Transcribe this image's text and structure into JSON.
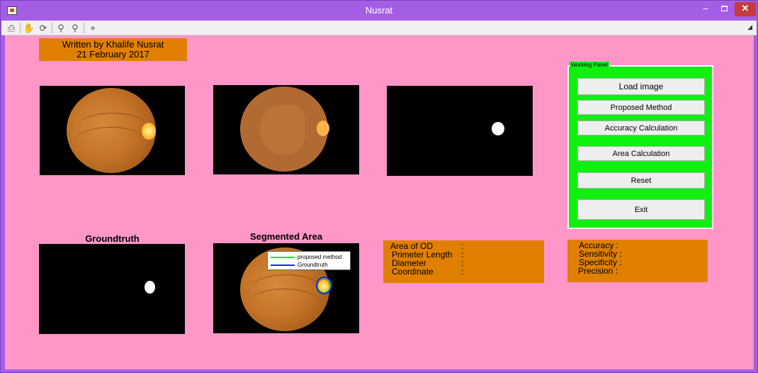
{
  "window": {
    "title": "Nusrat"
  },
  "toolbar": {
    "icons": [
      "print-icon",
      "pan-icon",
      "rotate-3d-icon",
      "zoom-in-icon",
      "zoom-out-icon",
      "data-cursor-icon"
    ]
  },
  "credit": {
    "line1": "Written by Khalife Nusrat",
    "line2": "21 February 2017"
  },
  "captions": {
    "groundtruth": "Groundtruth",
    "segmented": "Segmented Area"
  },
  "legend": {
    "items": [
      {
        "label": "proposed method",
        "color": "#22dd22"
      },
      {
        "label": "Groundtruth",
        "color": "#1a2ad8"
      }
    ]
  },
  "working_panel": {
    "title": "Working Panel",
    "buttons": {
      "load": "Load image",
      "proposed": "Proposed Method",
      "accuracy": "Accuracy Calculation",
      "area": "Area Calculation",
      "reset": "Reset",
      "exit": "Exit"
    }
  },
  "od_info": {
    "area": "Area  of OD",
    "perimeter": "Primeter Length",
    "diameter": "Diameter",
    "coordinate": "Coordinate",
    "sep": ":"
  },
  "metrics": {
    "accuracy": "Accuracy  :",
    "sensitivity": "Sensitivity :",
    "specificity": "Specificity :",
    "precision": "Precision   :"
  },
  "colors": {
    "background": "#ff96c8",
    "titlebar": "#a45ee6",
    "orange": "#e07f00",
    "panel_green": "#10f010"
  }
}
